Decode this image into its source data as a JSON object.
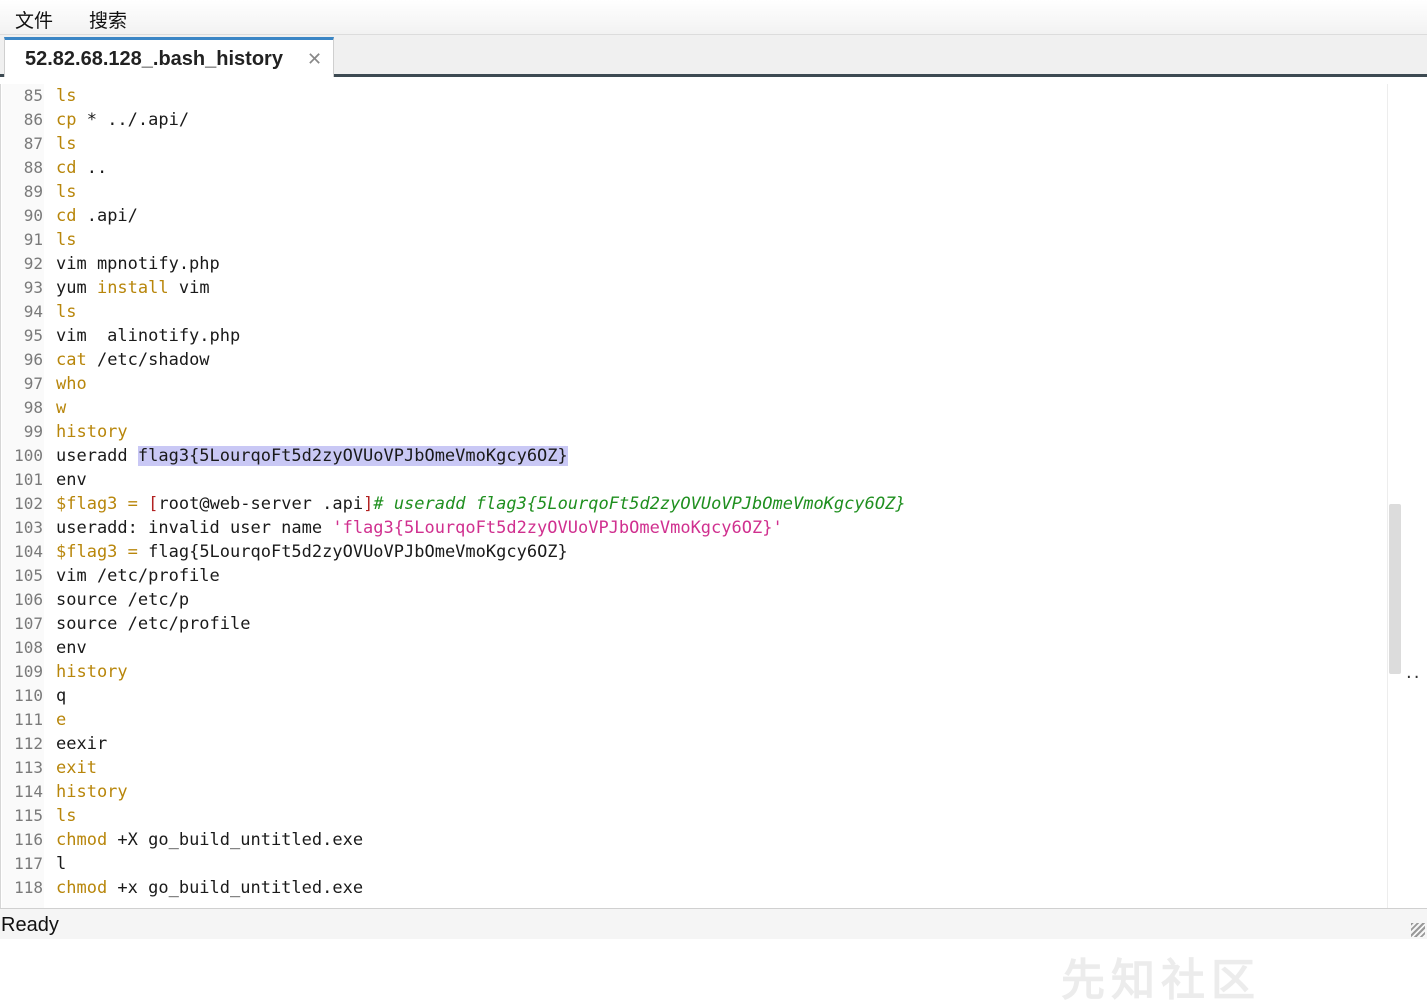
{
  "menu": {
    "file": "文件",
    "search": "搜索"
  },
  "tab": {
    "title": "52.82.68.128_.bash_history",
    "close": "✕"
  },
  "status": {
    "text": "Ready"
  },
  "watermark": "先知社区",
  "lines": [
    {
      "n": "85",
      "segs": [
        {
          "t": "ls",
          "c": "kw"
        }
      ]
    },
    {
      "n": "86",
      "segs": [
        {
          "t": "cp",
          "c": "kw"
        },
        {
          "t": " * ../.api/",
          "c": ""
        }
      ]
    },
    {
      "n": "87",
      "segs": [
        {
          "t": "ls",
          "c": "kw"
        }
      ]
    },
    {
      "n": "88",
      "segs": [
        {
          "t": "cd",
          "c": "kw"
        },
        {
          "t": " ..",
          "c": ""
        }
      ]
    },
    {
      "n": "89",
      "segs": [
        {
          "t": "ls",
          "c": "kw"
        }
      ]
    },
    {
      "n": "90",
      "segs": [
        {
          "t": "cd",
          "c": "kw"
        },
        {
          "t": " .api/",
          "c": ""
        }
      ]
    },
    {
      "n": "91",
      "segs": [
        {
          "t": "ls",
          "c": "kw"
        }
      ]
    },
    {
      "n": "92",
      "segs": [
        {
          "t": "vim mpnotify.php",
          "c": ""
        }
      ]
    },
    {
      "n": "93",
      "segs": [
        {
          "t": "yum ",
          "c": ""
        },
        {
          "t": "install",
          "c": "kw"
        },
        {
          "t": " vim",
          "c": ""
        }
      ]
    },
    {
      "n": "94",
      "segs": [
        {
          "t": "ls",
          "c": "kw"
        }
      ]
    },
    {
      "n": "95",
      "segs": [
        {
          "t": "vim  alinotify.php",
          "c": ""
        }
      ]
    },
    {
      "n": "96",
      "segs": [
        {
          "t": "cat",
          "c": "kw"
        },
        {
          "t": " /etc/shadow",
          "c": ""
        }
      ]
    },
    {
      "n": "97",
      "segs": [
        {
          "t": "who",
          "c": "kw"
        }
      ]
    },
    {
      "n": "98",
      "segs": [
        {
          "t": "w",
          "c": "kw"
        }
      ]
    },
    {
      "n": "99",
      "segs": [
        {
          "t": "history",
          "c": "kw"
        }
      ]
    },
    {
      "n": "100",
      "segs": [
        {
          "t": "useradd ",
          "c": ""
        },
        {
          "t": "flag3{5LourqoFt5d2zyOVUoVPJbOmeVmoKgcy6OZ}",
          "c": "hl"
        }
      ]
    },
    {
      "n": "101",
      "segs": [
        {
          "t": "env",
          "c": ""
        }
      ]
    },
    {
      "n": "102",
      "segs": [
        {
          "t": "$flag3",
          "c": "kw"
        },
        {
          "t": " = ",
          "c": "kw"
        },
        {
          "t": "[",
          "c": "red"
        },
        {
          "t": "root@web-server .api",
          "c": ""
        },
        {
          "t": "]",
          "c": "red"
        },
        {
          "t": "# useradd flag3{5LourqoFt5d2zyOVUoVPJbOmeVmoKgcy6OZ}",
          "c": "ital"
        }
      ]
    },
    {
      "n": "103",
      "segs": [
        {
          "t": "useradd: invalid user name ",
          "c": ""
        },
        {
          "t": "'flag3{5LourqoFt5d2zyOVUoVPJbOmeVmoKgcy6OZ}'",
          "c": "str"
        }
      ]
    },
    {
      "n": "104",
      "segs": [
        {
          "t": "$flag3",
          "c": "kw"
        },
        {
          "t": " = ",
          "c": "kw"
        },
        {
          "t": "flag{5LourqoFt5d2zyOVUoVPJbOmeVmoKgcy6OZ}",
          "c": ""
        }
      ]
    },
    {
      "n": "105",
      "segs": [
        {
          "t": "vim /etc/profile",
          "c": ""
        }
      ]
    },
    {
      "n": "106",
      "segs": [
        {
          "t": "source /etc/p",
          "c": ""
        }
      ]
    },
    {
      "n": "107",
      "segs": [
        {
          "t": "source /etc/profile",
          "c": ""
        }
      ]
    },
    {
      "n": "108",
      "segs": [
        {
          "t": "env",
          "c": ""
        }
      ]
    },
    {
      "n": "109",
      "segs": [
        {
          "t": "history",
          "c": "kw"
        }
      ]
    },
    {
      "n": "110",
      "segs": [
        {
          "t": "q",
          "c": ""
        }
      ]
    },
    {
      "n": "111",
      "segs": [
        {
          "t": "e",
          "c": "kw"
        }
      ]
    },
    {
      "n": "112",
      "segs": [
        {
          "t": "eexir",
          "c": ""
        }
      ]
    },
    {
      "n": "113",
      "segs": [
        {
          "t": "exit",
          "c": "kw"
        }
      ]
    },
    {
      "n": "114",
      "segs": [
        {
          "t": "history",
          "c": "kw"
        }
      ]
    },
    {
      "n": "115",
      "segs": [
        {
          "t": "ls",
          "c": "kw"
        }
      ]
    },
    {
      "n": "116",
      "segs": [
        {
          "t": "chmod",
          "c": "kw"
        },
        {
          "t": " +X go_build_untitled.exe",
          "c": ""
        }
      ]
    },
    {
      "n": "117",
      "segs": [
        {
          "t": "l",
          "c": ""
        }
      ]
    },
    {
      "n": "118",
      "segs": [
        {
          "t": "chmod",
          "c": "kw"
        },
        {
          "t": " +x go_build_untitled.exe",
          "c": ""
        }
      ]
    }
  ]
}
